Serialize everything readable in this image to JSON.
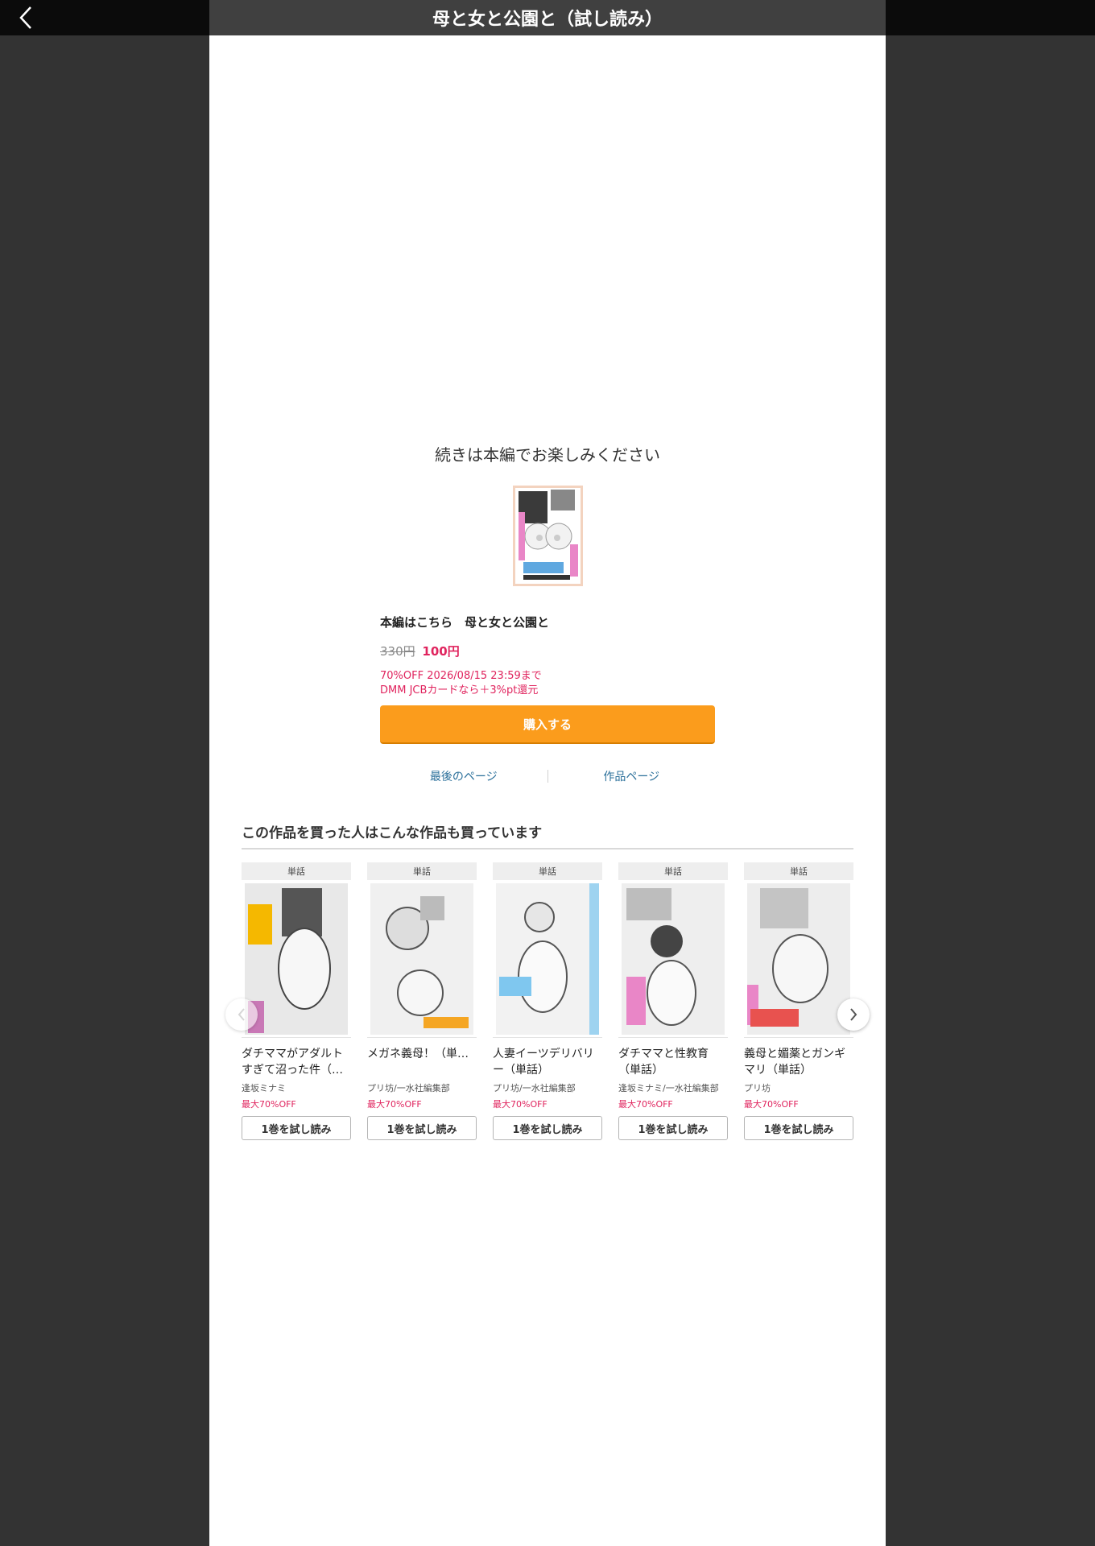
{
  "header": {
    "title": "母と女と公園と（試し読み）",
    "back_icon": "chevron-left-icon"
  },
  "end_panel": {
    "message": "続きは本編でお楽しみください",
    "cover_alt": "母と女と公園と",
    "product_title": "本編はこちら　母と女と公園と",
    "price_original": "330円",
    "price_sale": "100円",
    "discount_line": "70%OFF 2026/08/15 23:59まで",
    "card_bonus": "DMM JCBカードなら＋3%pt還元",
    "buy_label": "購入する",
    "last_page_label": "最後のページ",
    "work_page_label": "作品ページ"
  },
  "recommendations": {
    "title": "この作品を買った人はこんな作品も買っています",
    "items": [
      {
        "label": "単話",
        "name": "ダチママがアダルトすぎて沼った件（…",
        "author": "逢坂ミナミ",
        "discount": "最大70%OFF",
        "button": "1巻を試し読み"
      },
      {
        "label": "単話",
        "name": "メガネ義母！（単…",
        "author": "プリ坊/一水社編集部",
        "discount": "最大70%OFF",
        "button": "1巻を試し読み"
      },
      {
        "label": "単話",
        "name": "人妻イーツデリバリー（単話）",
        "author": "プリ坊/一水社編集部",
        "discount": "最大70%OFF",
        "button": "1巻を試し読み"
      },
      {
        "label": "単話",
        "name": "ダチママと性教育（単話）",
        "author": "逢坂ミナミ/一水社編集部",
        "discount": "最大70%OFF",
        "button": "1巻を試し読み"
      },
      {
        "label": "単話",
        "name": "義母と媚薬とガンギマリ（単話）",
        "author": "プリ坊",
        "discount": "最大70%OFF",
        "button": "1巻を試し読み"
      }
    ],
    "prev_icon": "chevron-left-icon",
    "next_icon": "chevron-right-icon"
  },
  "colors": {
    "accent_orange": "#fb9c1c",
    "sale_pink": "#e0245e",
    "link_blue": "#2a6f9a",
    "backdrop": "#333333"
  }
}
